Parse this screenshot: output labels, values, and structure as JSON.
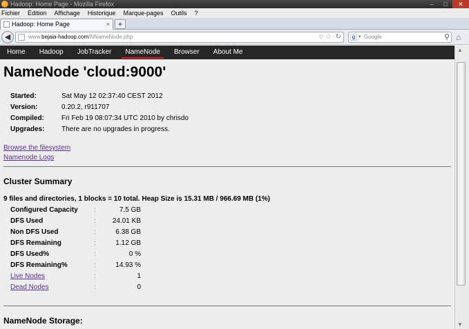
{
  "window": {
    "title": "Hadoop: Home Page - Mozilla Firefox",
    "buttons": [
      "–",
      "□",
      "✕"
    ]
  },
  "menu": [
    "Fichier",
    "Édition",
    "Affichage",
    "Historique",
    "Marque-pages",
    "Outils",
    "?"
  ],
  "tab": {
    "title": "Hadoop: Home Page",
    "close": "×",
    "new": "+"
  },
  "nav": {
    "url_host": "www.",
    "url_domain": "bejaia-hadoop.com",
    "url_path": "/NNameNode.php",
    "search_placeholder": "Google"
  },
  "site_nav": [
    {
      "label": "Home",
      "active": false
    },
    {
      "label": "Hadoop",
      "active": false
    },
    {
      "label": "JobTracker",
      "active": false
    },
    {
      "label": "NameNode",
      "active": true
    },
    {
      "label": "Browser",
      "active": false
    },
    {
      "label": "About Me",
      "active": false
    }
  ],
  "page": {
    "heading": "NameNode 'cloud:9000'",
    "info": [
      {
        "label": "Started:",
        "value": "Sat May 12 02:37:40 CEST 2012"
      },
      {
        "label": "Version:",
        "value": "0.20.2, r911707"
      },
      {
        "label": "Compiled:",
        "value": "Fri Feb 19 08:07:34 UTC 2010 by chrisdo"
      },
      {
        "label": "Upgrades:",
        "value": "There are no upgrades in progress."
      }
    ],
    "links": [
      "Browse the filesystem",
      "Namenode Logs"
    ],
    "cluster_heading": "Cluster Summary",
    "summary": "9 files and directories, 1 blocks = 10 total. Heap Size is 15.31 MB / 966.69 MB (1%)",
    "stats": [
      {
        "label": "Configured Capacity",
        "value": "7.5 GB",
        "link": false
      },
      {
        "label": "DFS Used",
        "value": "24.01 KB",
        "link": false
      },
      {
        "label": "Non DFS Used",
        "value": "6.38 GB",
        "link": false
      },
      {
        "label": "DFS Remaining",
        "value": "1.12 GB",
        "link": false
      },
      {
        "label": "DFS Used%",
        "value": "0 %",
        "link": false
      },
      {
        "label": "DFS Remaining%",
        "value": "14.93 %",
        "link": false
      },
      {
        "label": "Live Nodes",
        "value": "1",
        "link": true
      },
      {
        "label": "Dead Nodes",
        "value": "0",
        "link": true
      }
    ],
    "colon": ":",
    "storage_heading": "NameNode Storage:"
  }
}
